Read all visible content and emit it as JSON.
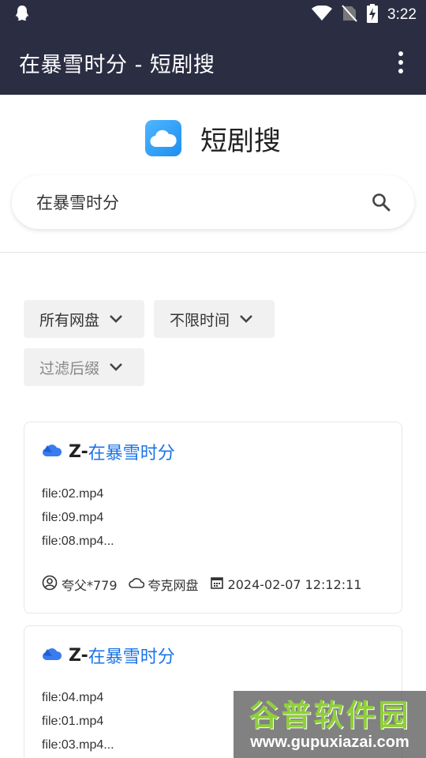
{
  "status_bar": {
    "time": "3:22"
  },
  "app_bar": {
    "title": "在暴雪时分 - 短剧搜"
  },
  "brand": {
    "name": "短剧搜"
  },
  "search": {
    "value": "在暴雪时分"
  },
  "filters": [
    {
      "label": "所有网盘"
    },
    {
      "label": "不限时间"
    },
    {
      "label": "过滤后缀"
    }
  ],
  "results": [
    {
      "prefix": "Z-",
      "title": "在暴雪时分",
      "files": [
        "file:02.mp4",
        "file:09.mp4",
        "file:08.mp4..."
      ],
      "user": "夸父*779",
      "drive": "夸克网盘",
      "date": "2024-02-07 12:12:11"
    },
    {
      "prefix": "Z-",
      "title": "在暴雪时分",
      "files": [
        "file:04.mp4",
        "file:01.mp4",
        "file:03.mp4..."
      ]
    }
  ],
  "watermark": {
    "title": "谷普软件园",
    "url": "www.gupuxiazai.com"
  },
  "colors": {
    "header_bg": "#2b2d42",
    "link": "#1a73e8",
    "chip_bg": "#f1f1f1"
  }
}
